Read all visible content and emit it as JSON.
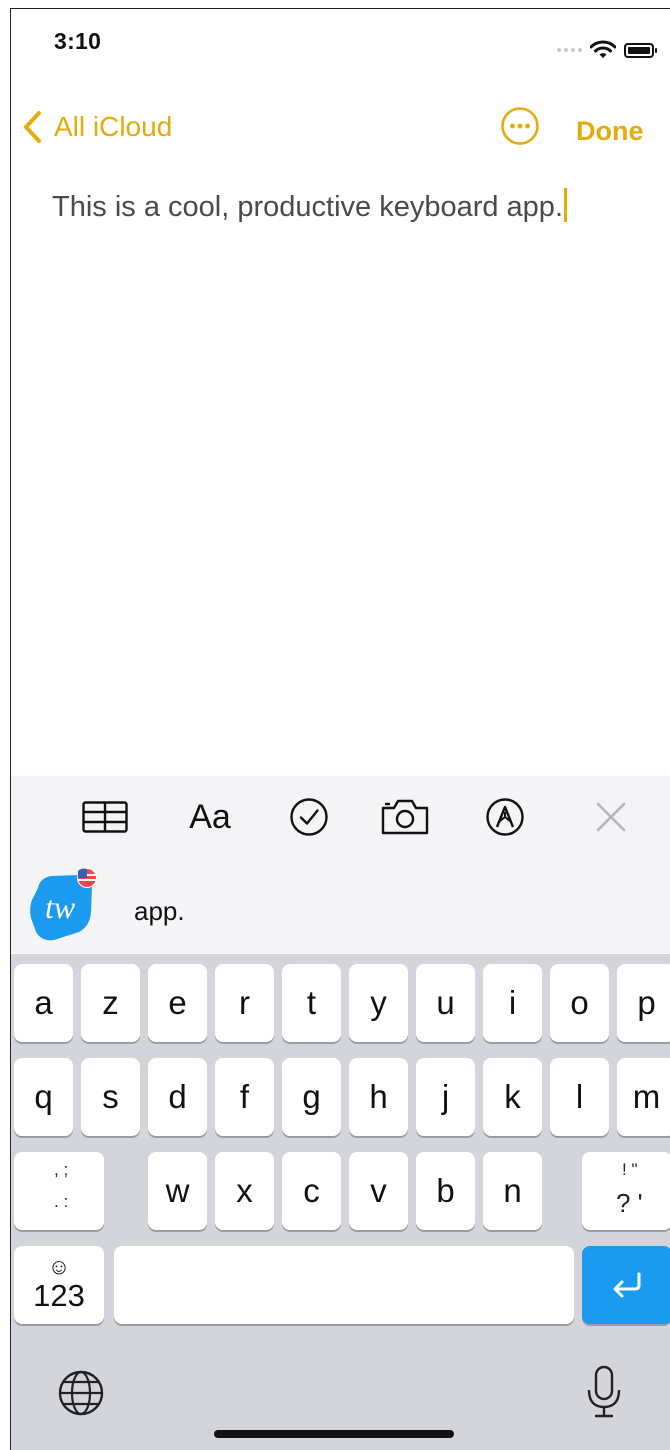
{
  "status_bar": {
    "time": "3:10"
  },
  "nav": {
    "back_label": "All iCloud",
    "done_label": "Done"
  },
  "note": {
    "text": "This is a cool, productive keyboard app."
  },
  "format_toolbar": {
    "text_style_label": "Aa"
  },
  "suggestion_bar": {
    "suggestion": "app.",
    "logo_text": "tw"
  },
  "keyboard": {
    "row1": [
      "a",
      "z",
      "e",
      "r",
      "t",
      "y",
      "u",
      "i",
      "o",
      "p"
    ],
    "row2": [
      "q",
      "s",
      "d",
      "f",
      "g",
      "h",
      "j",
      "k",
      "l",
      "m"
    ],
    "row3": [
      "w",
      "x",
      "c",
      "v",
      "b",
      "n"
    ],
    "left_punct": {
      "top": ", ;",
      "bottom": ". :"
    },
    "right_punct": {
      "top": "! \"",
      "bottom": "? '"
    },
    "numbers_label": "123",
    "emoji_glyph": "☺",
    "return_glyph": "↩"
  },
  "colors": {
    "accent": "#e5ab0b",
    "return_key": "#1a9bf0",
    "keyboard_bg": "#d4d5da",
    "logo": "#1a9bf0"
  }
}
